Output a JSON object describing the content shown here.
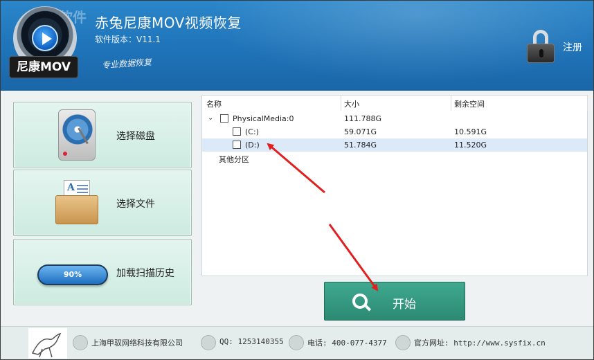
{
  "header": {
    "title": "赤兔尼康MOV视频恢复",
    "version": "软件版本：V11.1",
    "slogan": "专业数据恢复",
    "logo_text": "尼康MOV",
    "register_label": "注册",
    "watermark_text": "河东软件园"
  },
  "sidebar": {
    "items": [
      {
        "label": "选择磁盘",
        "icon": "hard-disk-icon"
      },
      {
        "label": "选择文件",
        "icon": "folder-document-icon"
      },
      {
        "label": "加载扫描历史",
        "icon": "progress-icon",
        "progress_text": "90%"
      }
    ]
  },
  "tree": {
    "columns": [
      "名称",
      "大小",
      "剩余空间"
    ],
    "rows": [
      {
        "name": "PhysicalMedia:0",
        "size": "111.788G",
        "free": "",
        "level": 0
      },
      {
        "name": "(C:)",
        "size": "59.071G",
        "free": "10.591G",
        "level": 1
      },
      {
        "name": "(D:)",
        "size": "51.784G",
        "free": "11.520G",
        "level": 1,
        "selected": true
      },
      {
        "name": "其他分区",
        "size": "",
        "free": "",
        "level": 0
      }
    ]
  },
  "start_button": {
    "label": "开始"
  },
  "footer": {
    "company": "上海甲驭网络科技有限公司",
    "qq": "QQ: 1253140355",
    "phone": "电话: 400-077-4377",
    "website": "官方网址: http://www.sysfix.cn"
  },
  "colors": {
    "header_blue": "#1f73b8",
    "panel_green": "#cdebe0",
    "start_green": "#2c8a73",
    "arrow_red": "#e02020",
    "selected_row": "#dbe9f9"
  }
}
